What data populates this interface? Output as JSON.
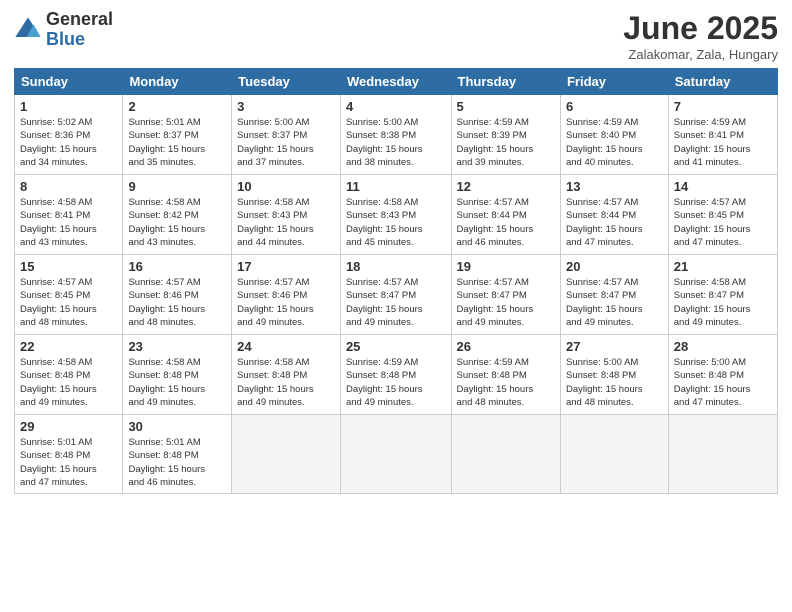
{
  "logo": {
    "general": "General",
    "blue": "Blue"
  },
  "title": "June 2025",
  "subtitle": "Zalakomar, Zala, Hungary",
  "days_of_week": [
    "Sunday",
    "Monday",
    "Tuesday",
    "Wednesday",
    "Thursday",
    "Friday",
    "Saturday"
  ],
  "weeks": [
    [
      {
        "day": "1",
        "info": "Sunrise: 5:02 AM\nSunset: 8:36 PM\nDaylight: 15 hours\nand 34 minutes."
      },
      {
        "day": "2",
        "info": "Sunrise: 5:01 AM\nSunset: 8:37 PM\nDaylight: 15 hours\nand 35 minutes."
      },
      {
        "day": "3",
        "info": "Sunrise: 5:00 AM\nSunset: 8:37 PM\nDaylight: 15 hours\nand 37 minutes."
      },
      {
        "day": "4",
        "info": "Sunrise: 5:00 AM\nSunset: 8:38 PM\nDaylight: 15 hours\nand 38 minutes."
      },
      {
        "day": "5",
        "info": "Sunrise: 4:59 AM\nSunset: 8:39 PM\nDaylight: 15 hours\nand 39 minutes."
      },
      {
        "day": "6",
        "info": "Sunrise: 4:59 AM\nSunset: 8:40 PM\nDaylight: 15 hours\nand 40 minutes."
      },
      {
        "day": "7",
        "info": "Sunrise: 4:59 AM\nSunset: 8:41 PM\nDaylight: 15 hours\nand 41 minutes."
      }
    ],
    [
      {
        "day": "8",
        "info": "Sunrise: 4:58 AM\nSunset: 8:41 PM\nDaylight: 15 hours\nand 43 minutes."
      },
      {
        "day": "9",
        "info": "Sunrise: 4:58 AM\nSunset: 8:42 PM\nDaylight: 15 hours\nand 43 minutes."
      },
      {
        "day": "10",
        "info": "Sunrise: 4:58 AM\nSunset: 8:43 PM\nDaylight: 15 hours\nand 44 minutes."
      },
      {
        "day": "11",
        "info": "Sunrise: 4:58 AM\nSunset: 8:43 PM\nDaylight: 15 hours\nand 45 minutes."
      },
      {
        "day": "12",
        "info": "Sunrise: 4:57 AM\nSunset: 8:44 PM\nDaylight: 15 hours\nand 46 minutes."
      },
      {
        "day": "13",
        "info": "Sunrise: 4:57 AM\nSunset: 8:44 PM\nDaylight: 15 hours\nand 47 minutes."
      },
      {
        "day": "14",
        "info": "Sunrise: 4:57 AM\nSunset: 8:45 PM\nDaylight: 15 hours\nand 47 minutes."
      }
    ],
    [
      {
        "day": "15",
        "info": "Sunrise: 4:57 AM\nSunset: 8:45 PM\nDaylight: 15 hours\nand 48 minutes."
      },
      {
        "day": "16",
        "info": "Sunrise: 4:57 AM\nSunset: 8:46 PM\nDaylight: 15 hours\nand 48 minutes."
      },
      {
        "day": "17",
        "info": "Sunrise: 4:57 AM\nSunset: 8:46 PM\nDaylight: 15 hours\nand 49 minutes."
      },
      {
        "day": "18",
        "info": "Sunrise: 4:57 AM\nSunset: 8:47 PM\nDaylight: 15 hours\nand 49 minutes."
      },
      {
        "day": "19",
        "info": "Sunrise: 4:57 AM\nSunset: 8:47 PM\nDaylight: 15 hours\nand 49 minutes."
      },
      {
        "day": "20",
        "info": "Sunrise: 4:57 AM\nSunset: 8:47 PM\nDaylight: 15 hours\nand 49 minutes."
      },
      {
        "day": "21",
        "info": "Sunrise: 4:58 AM\nSunset: 8:47 PM\nDaylight: 15 hours\nand 49 minutes."
      }
    ],
    [
      {
        "day": "22",
        "info": "Sunrise: 4:58 AM\nSunset: 8:48 PM\nDaylight: 15 hours\nand 49 minutes."
      },
      {
        "day": "23",
        "info": "Sunrise: 4:58 AM\nSunset: 8:48 PM\nDaylight: 15 hours\nand 49 minutes."
      },
      {
        "day": "24",
        "info": "Sunrise: 4:58 AM\nSunset: 8:48 PM\nDaylight: 15 hours\nand 49 minutes."
      },
      {
        "day": "25",
        "info": "Sunrise: 4:59 AM\nSunset: 8:48 PM\nDaylight: 15 hours\nand 49 minutes."
      },
      {
        "day": "26",
        "info": "Sunrise: 4:59 AM\nSunset: 8:48 PM\nDaylight: 15 hours\nand 48 minutes."
      },
      {
        "day": "27",
        "info": "Sunrise: 5:00 AM\nSunset: 8:48 PM\nDaylight: 15 hours\nand 48 minutes."
      },
      {
        "day": "28",
        "info": "Sunrise: 5:00 AM\nSunset: 8:48 PM\nDaylight: 15 hours\nand 47 minutes."
      }
    ],
    [
      {
        "day": "29",
        "info": "Sunrise: 5:01 AM\nSunset: 8:48 PM\nDaylight: 15 hours\nand 47 minutes."
      },
      {
        "day": "30",
        "info": "Sunrise: 5:01 AM\nSunset: 8:48 PM\nDaylight: 15 hours\nand 46 minutes."
      },
      {
        "day": "",
        "info": ""
      },
      {
        "day": "",
        "info": ""
      },
      {
        "day": "",
        "info": ""
      },
      {
        "day": "",
        "info": ""
      },
      {
        "day": "",
        "info": ""
      }
    ]
  ]
}
